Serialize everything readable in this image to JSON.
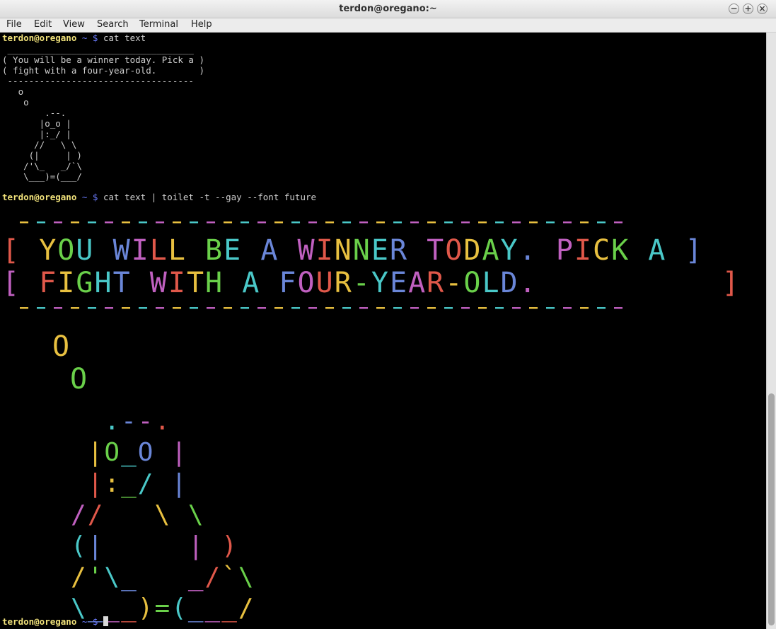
{
  "window": {
    "title": "terdon@oregano:~",
    "buttons": [
      "−",
      "+",
      "×"
    ]
  },
  "menu": [
    "File",
    "Edit",
    "View",
    "Search",
    "Terminal",
    "Help"
  ],
  "terminal": {
    "prompt_user": "terdon@oregano",
    "prompt_tail": " ~ $ ",
    "cmd1": "cat text",
    "cowsay": " ___________________________________\n( You will be a winner today. Pick a )\n( fight with a four-year-old.        )\n -----------------------------------\n   o\n    o\n        .--.\n       |o_o |\n       |:_/ |\n      //   \\ \\\n     (|     | )\n    /'\\_   _/`\\\n    \\___)=(___/",
    "cmd2": "cat text | toilet -t --gay --font future",
    "big_line1": "[ YOU WILL BE A WINNER TODAY. PICK A ]",
    "big_line2": "[ FIGHT WITH A FOUR-YEAR-OLD.          ]",
    "big_o1": "O",
    "big_o2": "O",
    "big_art": [
      "  .--.",
      " |O_O |",
      " |:_/ |",
      "//   \\ \\",
      "(|     | )",
      "/'\\_   _/`\\",
      "\\___)=(___/"
    ],
    "cmd3": ""
  },
  "colors": {
    "rainbow": [
      "#e0584a",
      "#e8c040",
      "#6ad04a",
      "#4ac8c8",
      "#6a86d8",
      "#c060c0"
    ],
    "prompt_user": "#f0e17a",
    "prompt_tilde": "#6b7cff"
  }
}
